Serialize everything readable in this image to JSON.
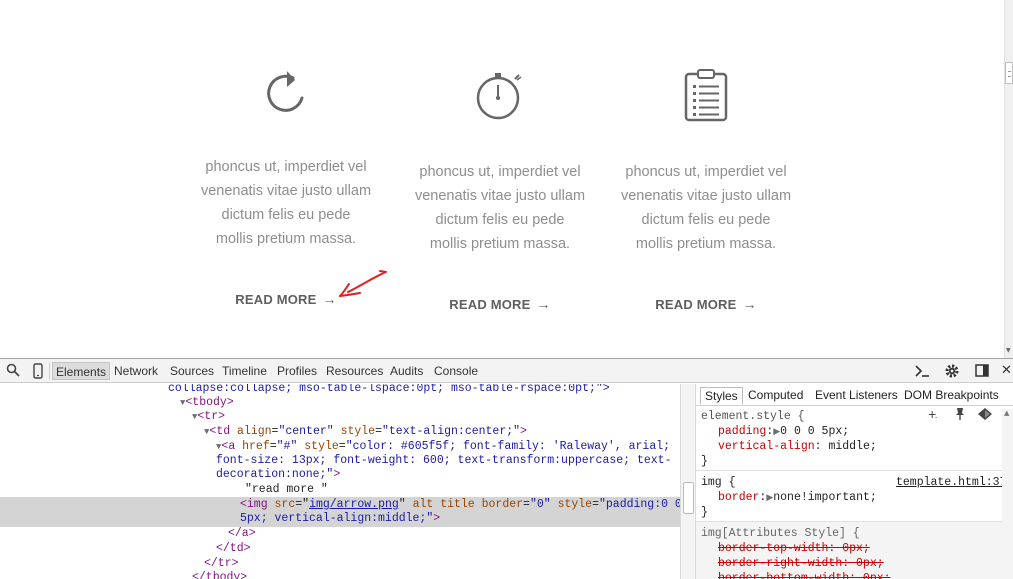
{
  "page": {
    "columns": [
      {
        "icon": "refresh-icon",
        "text_lines": [
          "phoncus ut, imperdiet vel",
          "venenatis vitae justo ullam",
          "dictum felis eu pede",
          "mollis pretium massa."
        ],
        "read_more": "READ MORE",
        "arrow": "→"
      },
      {
        "icon": "stopwatch-icon",
        "text_lines": [
          "phoncus ut, imperdiet vel",
          "venenatis vitae justo ullam",
          "dictum felis eu pede",
          "mollis pretium massa."
        ],
        "read_more": "READ MORE",
        "arrow": "→"
      },
      {
        "icon": "clipboard-list-icon",
        "text_lines": [
          "phoncus ut, imperdiet vel",
          "venenatis vitae justo ullam",
          "dictum felis eu pede",
          "mollis pretium massa."
        ],
        "read_more": "READ MORE",
        "arrow": "→"
      }
    ],
    "annotation": "red-hand-drawn-arrow-icon"
  },
  "devtools": {
    "tabs": [
      "Elements",
      "Network",
      "Sources",
      "Timeline",
      "Profiles",
      "Resources",
      "Audits",
      "Console"
    ],
    "active_tab": "Elements",
    "dom_lines": {
      "l0": "collapse:collapse; mso-table-lspace:0pt; mso-table-rspace:0pt;\">",
      "tbody_open": "<tbody>",
      "tr_open": "<tr>",
      "td_tag": "td",
      "td_attr1": "align",
      "td_val1": "\"center\"",
      "td_attr2": "style",
      "td_val2": "\"text-align:center;\"",
      "a_tag": "a",
      "a_attr1": "href",
      "a_val1": "\"#\"",
      "a_attr2": "style",
      "a_val2_l1": "\"color: #605f5f; font-family: 'Raleway', arial;",
      "a_val2_l2": "font-size: 13px; font-weight: 600; text-transform:uppercase; text-",
      "a_val2_l3": "decoration:none;\"",
      "read_more_text": "\"read more \"",
      "img_tag": "img",
      "img_attr_src": "src",
      "img_src_val": "img/arrow.png",
      "img_rest1": "alt title",
      "img_attr_border": "border",
      "img_border_val": "\"0\"",
      "img_attr_style": "style",
      "img_style_l1": "\"padding:0 0 0",
      "img_style_l2": "5px; vertical-align:middle;\"",
      "a_close": "</a>",
      "td_close": "</td>",
      "tr_close": "</tr>",
      "tbody_close": "</tbody>"
    },
    "side_tabs": [
      "Styles",
      "Computed",
      "Event Listeners",
      "DOM Breakpoints"
    ],
    "active_side_tab": "Styles",
    "styles": {
      "element_style_selector": "element.style {",
      "es_prop1": "padding",
      "es_val1": "0 0 0 5px;",
      "es_prop2": "vertical-align",
      "es_val2": "middle;",
      "close_brace": "}",
      "img_selector": "img {",
      "img_source": "template.html:37",
      "img_prop": "border",
      "img_val": "none!important;",
      "attr_style_selector": "img[Attributes Style] {",
      "strike1": "border-top-width: 0px;",
      "strike2": "border-right-width: 0px;",
      "strike3": "border-bottom-width: 0px;"
    }
  }
}
